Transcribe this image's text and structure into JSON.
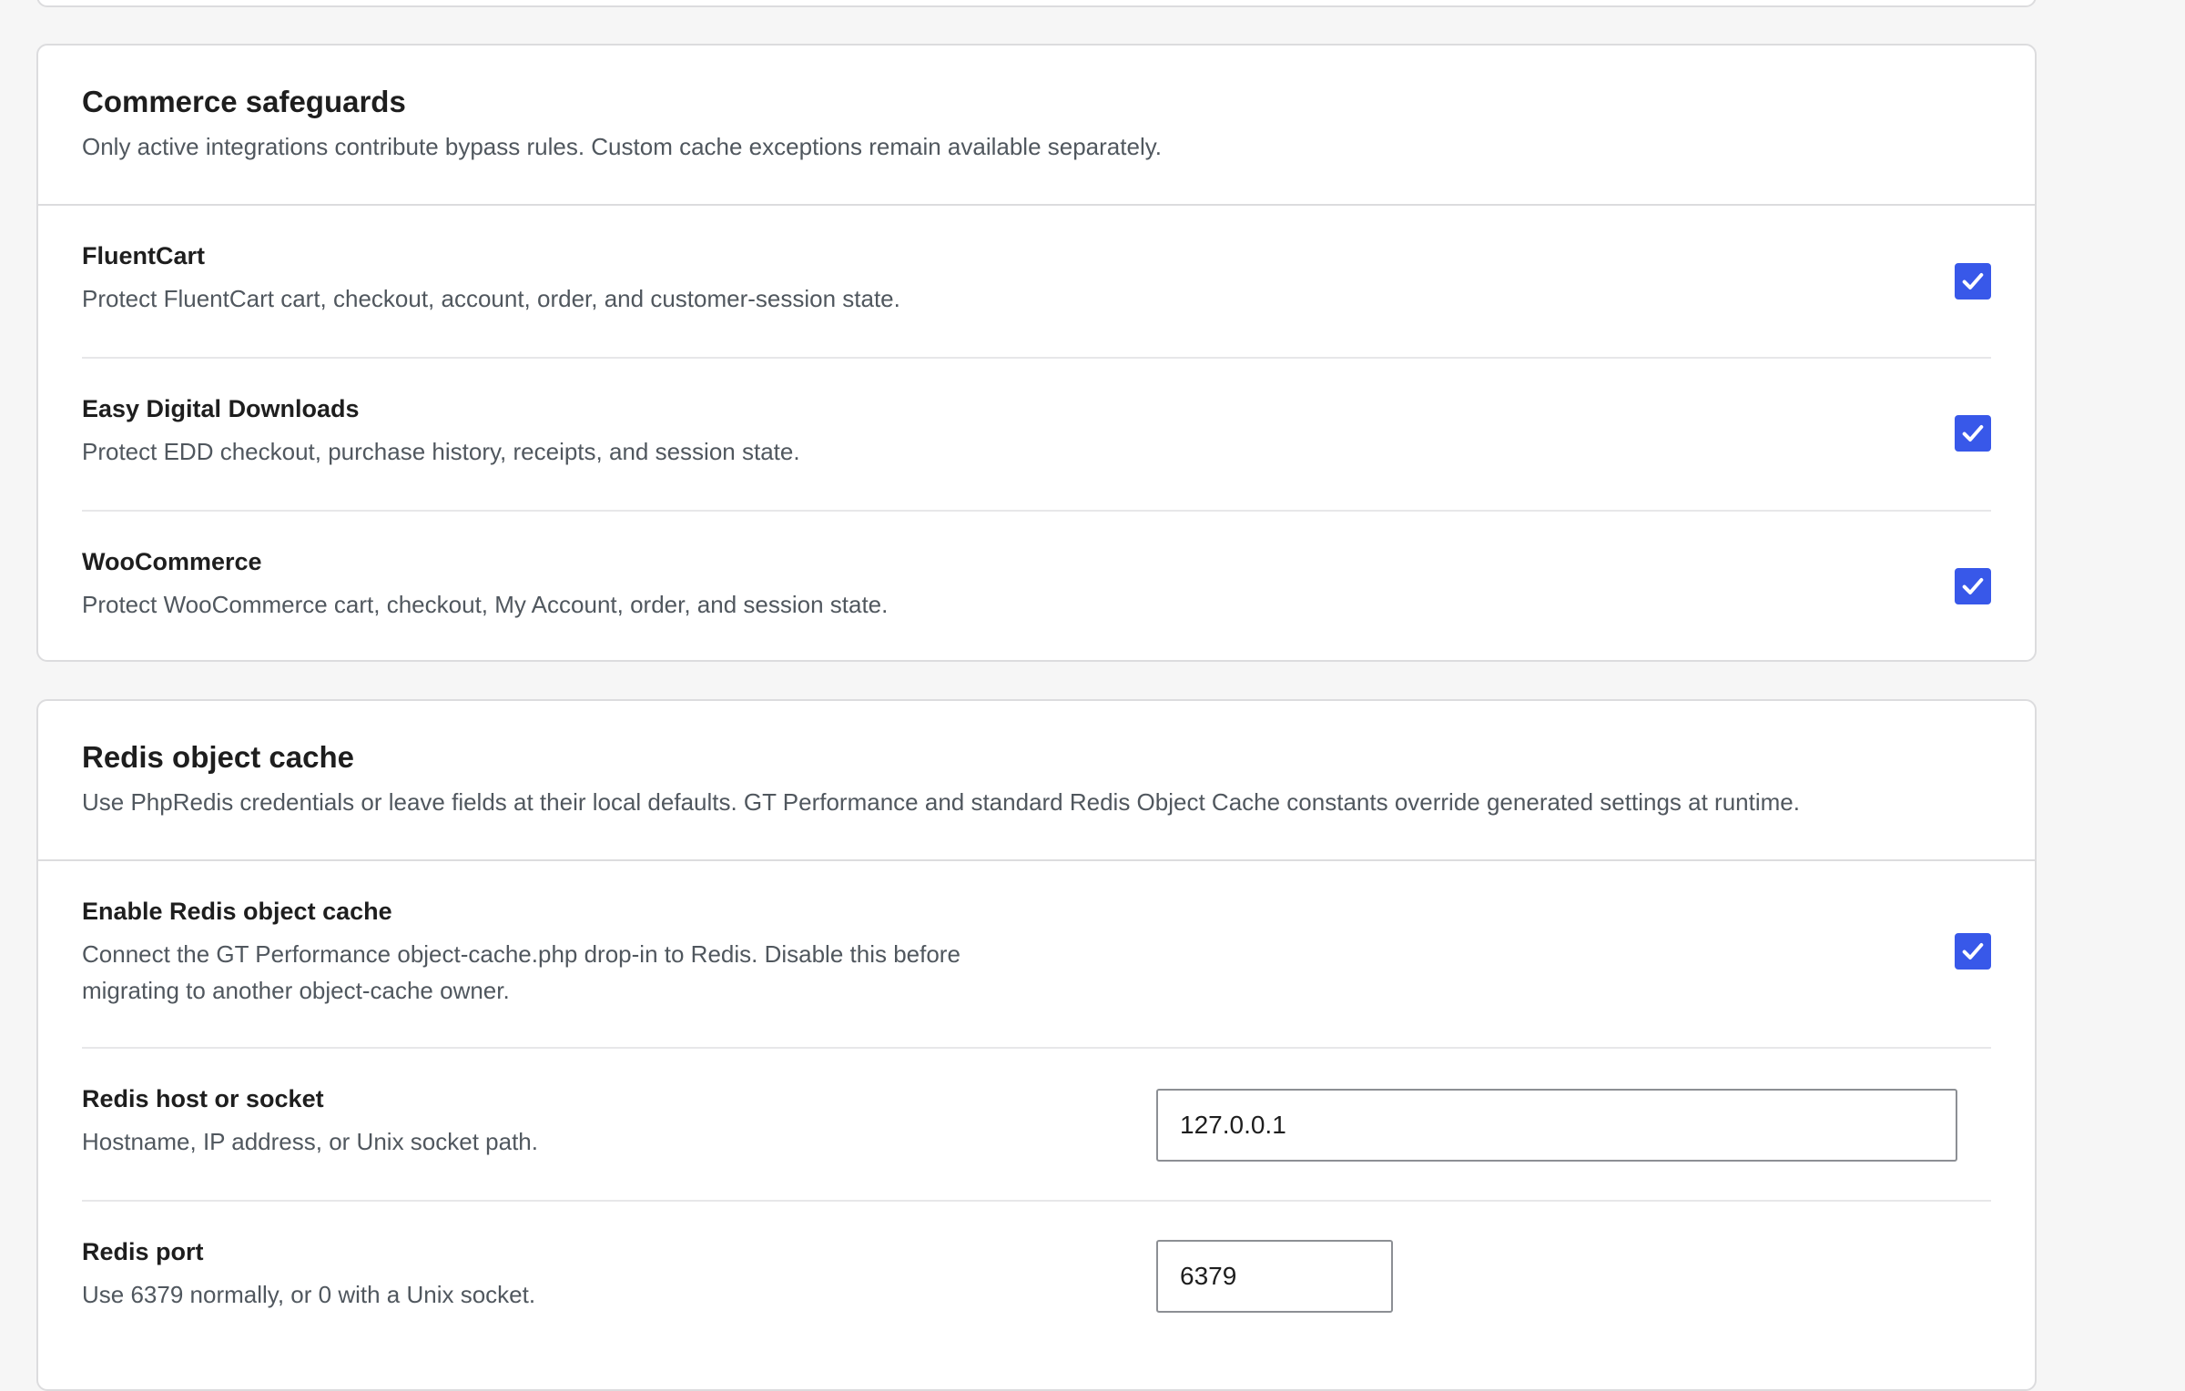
{
  "commerce": {
    "title": "Commerce safeguards",
    "description": "Only active integrations contribute bypass rules. Custom cache exceptions remain available separately.",
    "items": [
      {
        "label": "FluentCart",
        "help": "Protect FluentCart cart, checkout, account, order, and customer-session state.",
        "checked": true
      },
      {
        "label": "Easy Digital Downloads",
        "help": "Protect EDD checkout, purchase history, receipts, and session state.",
        "checked": true
      },
      {
        "label": "WooCommerce",
        "help": "Protect WooCommerce cart, checkout, My Account, order, and session state.",
        "checked": true
      }
    ]
  },
  "redis": {
    "title": "Redis object cache",
    "description": "Use PhpRedis credentials or leave fields at their local defaults. GT Performance and standard Redis Object Cache constants override generated settings at runtime.",
    "enable": {
      "label": "Enable Redis object cache",
      "help_line1": "Connect the GT Performance object-cache.php drop-in to Redis. Disable this before",
      "help_line2": "migrating to another object-cache owner.",
      "checked": true
    },
    "host": {
      "label": "Redis host or socket",
      "help": "Hostname, IP address, or Unix socket path.",
      "value": "127.0.0.1"
    },
    "port": {
      "label": "Redis port",
      "help": "Use 6379 normally, or 0 with a Unix socket.",
      "value": "6379"
    }
  },
  "colors": {
    "accent": "#3858e9",
    "background": "#f6f6f6",
    "card": "#ffffff",
    "border": "#dcdcde",
    "muted_text": "#50575e"
  },
  "icons": {
    "checkbox_check": "checkmark-icon"
  }
}
